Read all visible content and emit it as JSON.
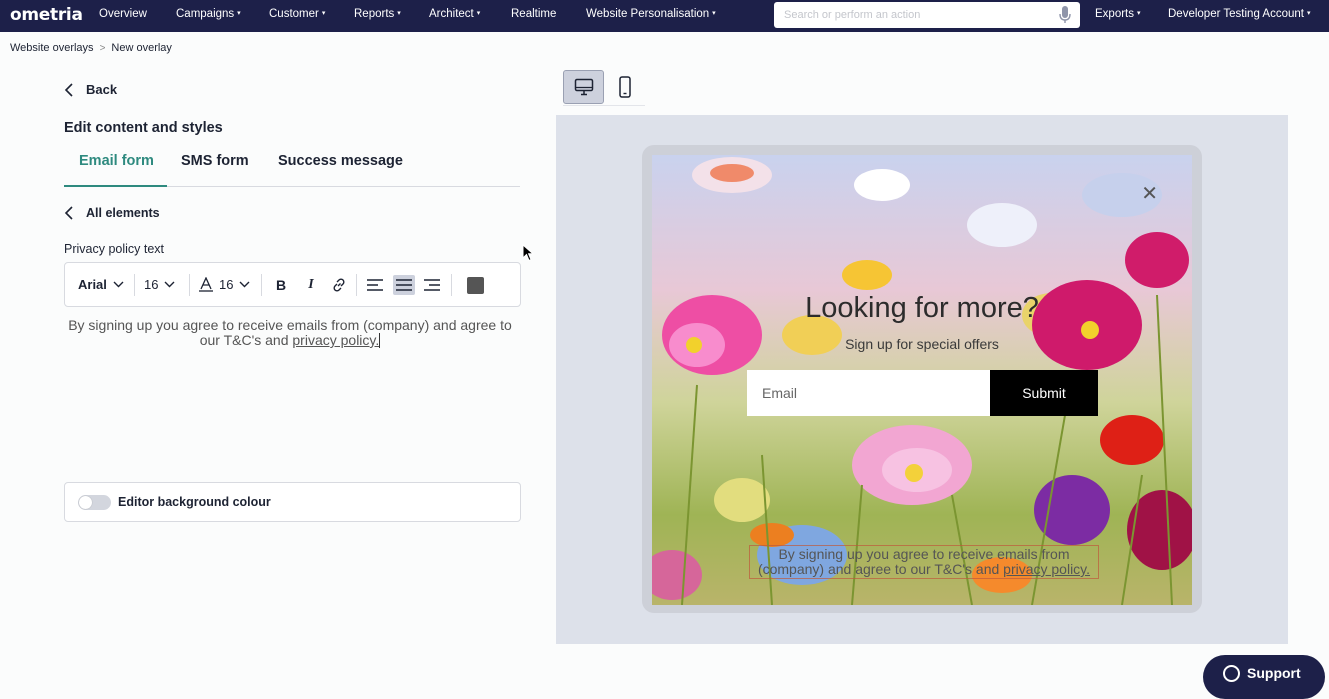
{
  "app": {
    "logo": "ometria"
  },
  "nav": {
    "items": [
      {
        "label": "Overview",
        "caret": false
      },
      {
        "label": "Campaigns",
        "caret": true
      },
      {
        "label": "Customer",
        "caret": true
      },
      {
        "label": "Reports",
        "caret": true
      },
      {
        "label": "Architect",
        "caret": true
      },
      {
        "label": "Realtime",
        "caret": false
      },
      {
        "label": "Website Personalisation",
        "caret": true
      }
    ],
    "search_placeholder": "Search or perform an action",
    "exports": "Exports",
    "account": "Developer Testing Account",
    "caret": "▾"
  },
  "breadcrumb": {
    "items": [
      "Website overlays",
      "New overlay"
    ],
    "separator": ">"
  },
  "editor": {
    "back_label": "Back",
    "title": "Edit content and styles",
    "tabs": [
      "Email form",
      "SMS form",
      "Success message"
    ],
    "active_tab": "Email form",
    "all_elements_label": "All elements",
    "field_label": "Privacy policy text",
    "toolbar": {
      "font_family": "Arial",
      "font_size": "16",
      "line_height": "16",
      "bold_icon": "B",
      "italic_icon": "I",
      "alignment_selected": "center"
    },
    "privacy_text_before": "By signing up you agree to receive emails from (company) and agree to our T&C's and ",
    "privacy_link": "privacy policy.",
    "bg_toggle_label": "Editor background colour",
    "bg_toggle_on": false
  },
  "preview": {
    "device_selected": "desktop",
    "popup": {
      "close_icon": "✕",
      "title": "Looking for more?",
      "subtitle": "Sign up for special offers",
      "email_placeholder": "Email",
      "submit_label": "Submit",
      "privacy_text_before": "By signing up you agree to receive emails from (company) and agree to our T&C's and ",
      "privacy_link": "privacy policy."
    }
  },
  "support": {
    "label": "Support"
  },
  "colors": {
    "nav_bg": "#1d2049",
    "accent": "#2e8a7f",
    "preview_bg": "#dde1ea"
  }
}
